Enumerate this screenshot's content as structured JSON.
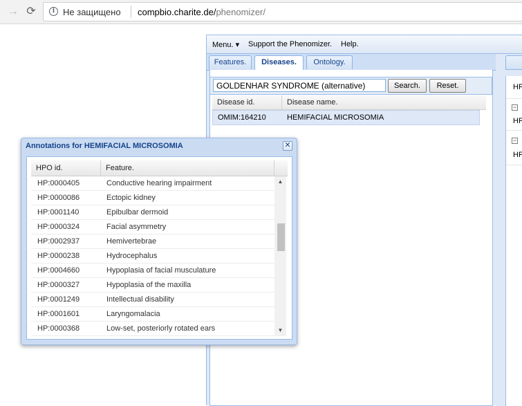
{
  "browser": {
    "back_icon": "arrow-left-icon",
    "reload_icon": "reload-icon",
    "info_icon": "info-icon",
    "security_label": "Не защищено",
    "url_host": "compbio.charite.de/",
    "url_path": "phenomizer/"
  },
  "menubar": {
    "menu": "Menu. ▾",
    "support": "Support the Phenomizer.",
    "help": "Help."
  },
  "tabs": [
    {
      "label": "Features."
    },
    {
      "label": "Diseases."
    },
    {
      "label": "Ontology."
    }
  ],
  "active_tab": "Diseases.",
  "search": {
    "value": "GOLDENHAR SYNDROME (alternative)",
    "search_label": "Search.",
    "reset_label": "Reset."
  },
  "disease_grid": {
    "columns": [
      "Disease id.",
      "Disease name."
    ],
    "rows": [
      {
        "id": "OMIM:164210",
        "name": "HEMIFACIAL MICROSOMIA"
      }
    ]
  },
  "right_panel": {
    "items": [
      "HP",
      "HP",
      "HP"
    ]
  },
  "dialog": {
    "title": "Annotations for HEMIFACIAL MICROSOMIA",
    "close_icon": "close-icon",
    "columns": [
      "HPO id.",
      "Feature."
    ],
    "rows": [
      {
        "id": "HP:0000405",
        "feature": "Conductive hearing impairment"
      },
      {
        "id": "HP:0000086",
        "feature": "Ectopic kidney"
      },
      {
        "id": "HP:0001140",
        "feature": "Epibulbar dermoid"
      },
      {
        "id": "HP:0000324",
        "feature": "Facial asymmetry"
      },
      {
        "id": "HP:0002937",
        "feature": "Hemivertebrae"
      },
      {
        "id": "HP:0000238",
        "feature": "Hydrocephalus"
      },
      {
        "id": "HP:0004660",
        "feature": "Hypoplasia of facial musculature"
      },
      {
        "id": "HP:0000327",
        "feature": "Hypoplasia of the maxilla"
      },
      {
        "id": "HP:0001249",
        "feature": "Intellectual disability"
      },
      {
        "id": "HP:0001601",
        "feature": "Laryngomalacia"
      },
      {
        "id": "HP:0000368",
        "feature": "Low-set, posteriorly rotated ears"
      }
    ]
  },
  "colors": {
    "accent": "#15428b",
    "panel_bg": "#dfe8f6",
    "border": "#99bbe8"
  }
}
